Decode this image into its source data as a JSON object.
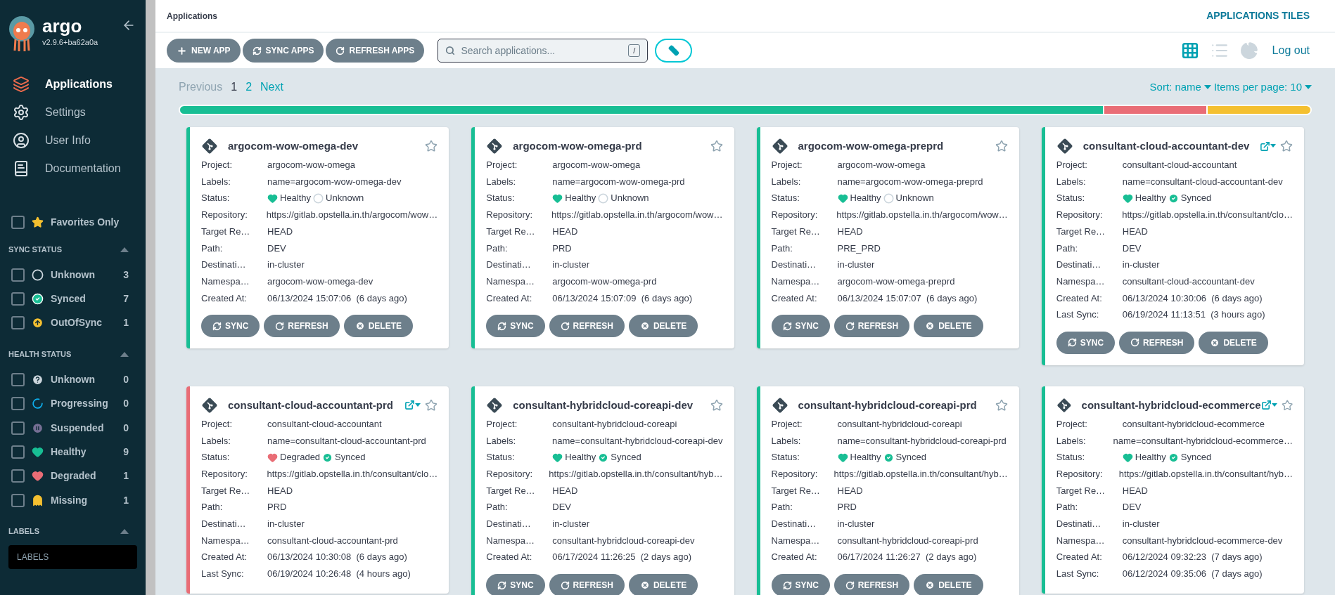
{
  "sidebar": {
    "logo_text": "argo",
    "version": "v2.9.6+ba62a0a",
    "nav": [
      {
        "label": "Applications",
        "kind": "applications",
        "selected": true
      },
      {
        "label": "Settings",
        "kind": "settings",
        "selected": false
      },
      {
        "label": "User Info",
        "kind": "user",
        "selected": false
      },
      {
        "label": "Documentation",
        "kind": "docs",
        "selected": false
      }
    ],
    "favorites": {
      "label": "Favorites Only",
      "checked": false
    },
    "filter_groups": [
      {
        "title": "SYNC STATUS",
        "expanded": true,
        "items": [
          {
            "label": "Unknown",
            "count": "3",
            "kind": "sync-unknown",
            "checked": false
          },
          {
            "label": "Synced",
            "count": "7",
            "kind": "synced",
            "checked": false
          },
          {
            "label": "OutOfSync",
            "count": "1",
            "kind": "outofsync",
            "checked": false
          }
        ]
      },
      {
        "title": "HEALTH STATUS",
        "expanded": true,
        "items": [
          {
            "label": "Unknown",
            "count": "0",
            "kind": "health-unknown",
            "checked": false
          },
          {
            "label": "Progressing",
            "count": "0",
            "kind": "progressing",
            "checked": false
          },
          {
            "label": "Suspended",
            "count": "0",
            "kind": "suspended",
            "checked": false
          },
          {
            "label": "Healthy",
            "count": "9",
            "kind": "healthy",
            "checked": false
          },
          {
            "label": "Degraded",
            "count": "1",
            "kind": "degraded",
            "checked": false
          },
          {
            "label": "Missing",
            "count": "1",
            "kind": "missing",
            "checked": false
          }
        ]
      },
      {
        "title": "LABELS",
        "expanded": true
      }
    ],
    "labels_field": {
      "placeholder": "LABELS"
    }
  },
  "header": {
    "title": "Applications",
    "view_title": "APPLICATIONS TILES"
  },
  "toolbar": {
    "buttons": [
      {
        "label": "NEW APP",
        "kind": "new"
      },
      {
        "label": "SYNC APPS",
        "kind": "sync"
      },
      {
        "label": "REFRESH APPS",
        "kind": "refresh"
      }
    ],
    "search": {
      "placeholder": "Search applications...",
      "shortcut": "/"
    },
    "view_modes": [
      {
        "kind": "tiles",
        "selected": true
      },
      {
        "kind": "list",
        "selected": false
      },
      {
        "kind": "summary",
        "selected": false
      }
    ],
    "logout": "Log out"
  },
  "pagination": {
    "previous": {
      "label": "Previous",
      "disabled": true
    },
    "pages": [
      {
        "label": "1",
        "selected": true
      },
      {
        "label": "2",
        "selected": false
      }
    ],
    "next": {
      "label": "Next",
      "disabled": false
    },
    "sort": "Sort: name",
    "items_per_page": "Items per page: 10"
  },
  "health_bar": [
    {
      "color": "#18be94",
      "kind": "healthy"
    },
    {
      "color": "#e96d76",
      "kind": "degraded"
    },
    {
      "color": "#f4c030",
      "kind": "missing"
    }
  ],
  "apps": [
    {
      "name": "argocom-wow-omega-dev",
      "has_links": false,
      "favorite": false,
      "fields": [
        {
          "label": "Project:",
          "kind": "text",
          "value": "argocom-wow-omega"
        },
        {
          "label": "Labels:",
          "kind": "text",
          "value": "name=argocom-wow-omega-dev"
        },
        {
          "label": "Status:",
          "kind": "status",
          "health": {
            "label": "Healthy",
            "kind": "healthy"
          },
          "sync": {
            "label": "Unknown",
            "kind": "sync-unknown"
          }
        },
        {
          "label": "Repository:",
          "kind": "text",
          "value": "https://gitlab.opstella.in.th/argocom/wow…"
        },
        {
          "label": "Target Re…",
          "kind": "text",
          "value": "HEAD"
        },
        {
          "label": "Path:",
          "kind": "text",
          "value": "DEV"
        },
        {
          "label": "Destinati…",
          "kind": "text",
          "value": "in-cluster"
        },
        {
          "label": "Namespa…",
          "kind": "text",
          "value": "argocom-wow-omega-dev"
        },
        {
          "label": "Created At:",
          "kind": "text",
          "value": "06/13/2024 15:07:06  (6 days ago)"
        }
      ],
      "buttons": [
        {
          "label": "SYNC",
          "kind": "sync"
        },
        {
          "label": "REFRESH",
          "kind": "refresh"
        },
        {
          "label": "DELETE",
          "kind": "delete"
        }
      ]
    },
    {
      "name": "argocom-wow-omega-prd",
      "has_links": false,
      "favorite": false,
      "fields": [
        {
          "label": "Project:",
          "kind": "text",
          "value": "argocom-wow-omega"
        },
        {
          "label": "Labels:",
          "kind": "text",
          "value": "name=argocom-wow-omega-prd"
        },
        {
          "label": "Status:",
          "kind": "status",
          "health": {
            "label": "Healthy",
            "kind": "healthy"
          },
          "sync": {
            "label": "Unknown",
            "kind": "sync-unknown"
          }
        },
        {
          "label": "Repository:",
          "kind": "text",
          "value": "https://gitlab.opstella.in.th/argocom/wow…"
        },
        {
          "label": "Target Re…",
          "kind": "text",
          "value": "HEAD"
        },
        {
          "label": "Path:",
          "kind": "text",
          "value": "PRD"
        },
        {
          "label": "Destinati…",
          "kind": "text",
          "value": "in-cluster"
        },
        {
          "label": "Namespa…",
          "kind": "text",
          "value": "argocom-wow-omega-prd"
        },
        {
          "label": "Created At:",
          "kind": "text",
          "value": "06/13/2024 15:07:09  (6 days ago)"
        }
      ],
      "buttons": [
        {
          "label": "SYNC",
          "kind": "sync"
        },
        {
          "label": "REFRESH",
          "kind": "refresh"
        },
        {
          "label": "DELETE",
          "kind": "delete"
        }
      ]
    },
    {
      "name": "argocom-wow-omega-preprd",
      "has_links": false,
      "favorite": false,
      "fields": [
        {
          "label": "Project:",
          "kind": "text",
          "value": "argocom-wow-omega"
        },
        {
          "label": "Labels:",
          "kind": "text",
          "value": "name=argocom-wow-omega-preprd"
        },
        {
          "label": "Status:",
          "kind": "status",
          "health": {
            "label": "Healthy",
            "kind": "healthy"
          },
          "sync": {
            "label": "Unknown",
            "kind": "sync-unknown"
          }
        },
        {
          "label": "Repository:",
          "kind": "text",
          "value": "https://gitlab.opstella.in.th/argocom/wow…"
        },
        {
          "label": "Target Re…",
          "kind": "text",
          "value": "HEAD"
        },
        {
          "label": "Path:",
          "kind": "text",
          "value": "PRE_PRD"
        },
        {
          "label": "Destinati…",
          "kind": "text",
          "value": "in-cluster"
        },
        {
          "label": "Namespa…",
          "kind": "text",
          "value": "argocom-wow-omega-preprd"
        },
        {
          "label": "Created At:",
          "kind": "text",
          "value": "06/13/2024 15:07:07  (6 days ago)"
        }
      ],
      "buttons": [
        {
          "label": "SYNC",
          "kind": "sync"
        },
        {
          "label": "REFRESH",
          "kind": "refresh"
        },
        {
          "label": "DELETE",
          "kind": "delete"
        }
      ]
    },
    {
      "name": "consultant-cloud-accountant-dev",
      "has_links": true,
      "favorite": false,
      "fields": [
        {
          "label": "Project:",
          "kind": "text",
          "value": "consultant-cloud-accountant"
        },
        {
          "label": "Labels:",
          "kind": "text",
          "value": "name=consultant-cloud-accountant-dev"
        },
        {
          "label": "Status:",
          "kind": "status",
          "health": {
            "label": "Healthy",
            "kind": "healthy"
          },
          "sync": {
            "label": "Synced",
            "kind": "synced"
          }
        },
        {
          "label": "Repository:",
          "kind": "text",
          "value": "https://gitlab.opstella.in.th/consultant/clo…"
        },
        {
          "label": "Target Re…",
          "kind": "text",
          "value": "HEAD"
        },
        {
          "label": "Path:",
          "kind": "text",
          "value": "DEV"
        },
        {
          "label": "Destinati…",
          "kind": "text",
          "value": "in-cluster"
        },
        {
          "label": "Namespa…",
          "kind": "text",
          "value": "consultant-cloud-accountant-dev"
        },
        {
          "label": "Created At:",
          "kind": "text",
          "value": "06/13/2024 10:30:06  (6 days ago)"
        },
        {
          "label": "Last Sync:",
          "kind": "text",
          "value": "06/19/2024 11:13:51  (3 hours ago)"
        }
      ],
      "buttons": [
        {
          "label": "SYNC",
          "kind": "sync"
        },
        {
          "label": "REFRESH",
          "kind": "refresh"
        },
        {
          "label": "DELETE",
          "kind": "delete"
        }
      ]
    },
    {
      "name": "consultant-cloud-accountant-prd",
      "has_links": true,
      "favorite": false,
      "fields": [
        {
          "label": "Project:",
          "kind": "text",
          "value": "consultant-cloud-accountant"
        },
        {
          "label": "Labels:",
          "kind": "text",
          "value": "name=consultant-cloud-accountant-prd"
        },
        {
          "label": "Status:",
          "kind": "status",
          "health": {
            "label": "Degraded",
            "kind": "degraded"
          },
          "sync": {
            "label": "Synced",
            "kind": "synced"
          }
        },
        {
          "label": "Repository:",
          "kind": "text",
          "value": "https://gitlab.opstella.in.th/consultant/clo…"
        },
        {
          "label": "Target Re…",
          "kind": "text",
          "value": "HEAD"
        },
        {
          "label": "Path:",
          "kind": "text",
          "value": "PRD"
        },
        {
          "label": "Destinati…",
          "kind": "text",
          "value": "in-cluster"
        },
        {
          "label": "Namespa…",
          "kind": "text",
          "value": "consultant-cloud-accountant-prd"
        },
        {
          "label": "Created At:",
          "kind": "text",
          "value": "06/13/2024 10:30:08  (6 days ago)"
        },
        {
          "label": "Last Sync:",
          "kind": "text",
          "value": "06/19/2024 10:26:48  (4 hours ago)"
        }
      ]
    },
    {
      "name": "consultant-hybridcloud-coreapi-dev",
      "has_links": false,
      "favorite": false,
      "fields": [
        {
          "label": "Project:",
          "kind": "text",
          "value": "consultant-hybridcloud-coreapi"
        },
        {
          "label": "Labels:",
          "kind": "text",
          "value": "name=consultant-hybridcloud-coreapi-dev"
        },
        {
          "label": "Status:",
          "kind": "status",
          "health": {
            "label": "Healthy",
            "kind": "healthy"
          },
          "sync": {
            "label": "Synced",
            "kind": "synced"
          }
        },
        {
          "label": "Repository:",
          "kind": "text",
          "value": "https://gitlab.opstella.in.th/consultant/hyb…"
        },
        {
          "label": "Target Re…",
          "kind": "text",
          "value": "HEAD"
        },
        {
          "label": "Path:",
          "kind": "text",
          "value": "DEV"
        },
        {
          "label": "Destinati…",
          "kind": "text",
          "value": "in-cluster"
        },
        {
          "label": "Namespa…",
          "kind": "text",
          "value": "consultant-hybridcloud-coreapi-dev"
        },
        {
          "label": "Created At:",
          "kind": "text",
          "value": "06/17/2024 11:26:25  (2 days ago)"
        }
      ],
      "buttons": [
        {
          "label": "SYNC",
          "kind": "sync"
        },
        {
          "label": "REFRESH",
          "kind": "refresh"
        },
        {
          "label": "DELETE",
          "kind": "delete"
        }
      ]
    },
    {
      "name": "consultant-hybridcloud-coreapi-prd",
      "has_links": false,
      "favorite": false,
      "fields": [
        {
          "label": "Project:",
          "kind": "text",
          "value": "consultant-hybridcloud-coreapi"
        },
        {
          "label": "Labels:",
          "kind": "text",
          "value": "name=consultant-hybridcloud-coreapi-prd"
        },
        {
          "label": "Status:",
          "kind": "status",
          "health": {
            "label": "Healthy",
            "kind": "healthy"
          },
          "sync": {
            "label": "Synced",
            "kind": "synced"
          }
        },
        {
          "label": "Repository:",
          "kind": "text",
          "value": "https://gitlab.opstella.in.th/consultant/hyb…"
        },
        {
          "label": "Target Re…",
          "kind": "text",
          "value": "HEAD"
        },
        {
          "label": "Path:",
          "kind": "text",
          "value": "PRD"
        },
        {
          "label": "Destinati…",
          "kind": "text",
          "value": "in-cluster"
        },
        {
          "label": "Namespa…",
          "kind": "text",
          "value": "consultant-hybridcloud-coreapi-prd"
        },
        {
          "label": "Created At:",
          "kind": "text",
          "value": "06/17/2024 11:26:27  (2 days ago)"
        }
      ],
      "buttons": [
        {
          "label": "SYNC",
          "kind": "sync"
        },
        {
          "label": "REFRESH",
          "kind": "refresh"
        },
        {
          "label": "DELETE",
          "kind": "delete"
        }
      ]
    },
    {
      "name": "consultant-hybridcloud-ecommerce",
      "has_links": true,
      "favorite": false,
      "fields": [
        {
          "label": "Project:",
          "kind": "text",
          "value": "consultant-hybridcloud-ecommerce"
        },
        {
          "label": "Labels:",
          "kind": "text",
          "value": "name=consultant-hybridcloud-ecommerce…"
        },
        {
          "label": "Status:",
          "kind": "status",
          "health": {
            "label": "Healthy",
            "kind": "healthy"
          },
          "sync": {
            "label": "Synced",
            "kind": "synced"
          }
        },
        {
          "label": "Repository:",
          "kind": "text",
          "value": "https://gitlab.opstella.in.th/consultant/hyb…"
        },
        {
          "label": "Target Re…",
          "kind": "text",
          "value": "HEAD"
        },
        {
          "label": "Path:",
          "kind": "text",
          "value": "DEV"
        },
        {
          "label": "Destinati…",
          "kind": "text",
          "value": "in-cluster"
        },
        {
          "label": "Namespa…",
          "kind": "text",
          "value": "consultant-hybridcloud-ecommerce-dev"
        },
        {
          "label": "Created At:",
          "kind": "text",
          "value": "06/12/2024 09:32:23  (7 days ago)"
        },
        {
          "label": "Last Sync:",
          "kind": "text",
          "value": "06/12/2024 09:35:06  (7 days ago)"
        }
      ]
    }
  ]
}
